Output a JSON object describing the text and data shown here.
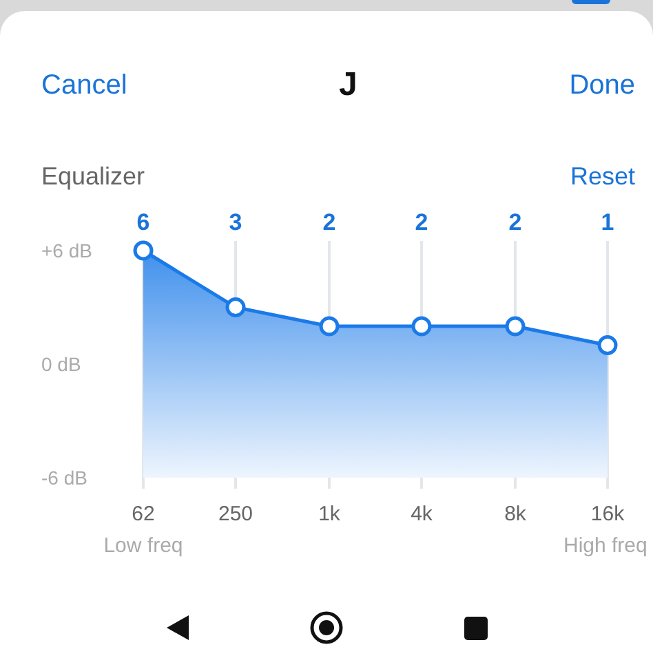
{
  "header": {
    "cancel": "Cancel",
    "title": "J",
    "done": "Done"
  },
  "equalizer": {
    "label": "Equalizer",
    "reset": "Reset",
    "band_gains": [
      "6",
      "3",
      "2",
      "2",
      "2",
      "1"
    ],
    "chart_data": {
      "type": "line",
      "categories": [
        "62",
        "250",
        "1k",
        "4k",
        "8k",
        "16k"
      ],
      "values": [
        6,
        3,
        2,
        2,
        2,
        1
      ],
      "grid": true,
      "ylim": [
        -6,
        6
      ],
      "yticks": [
        {
          "value": 6,
          "label": "+6 dB"
        },
        {
          "value": 0,
          "label": "0 dB"
        },
        {
          "value": -6,
          "label": "-6 dB"
        }
      ],
      "marker": true,
      "annotations": [
        "Low freq",
        "High freq"
      ]
    }
  }
}
